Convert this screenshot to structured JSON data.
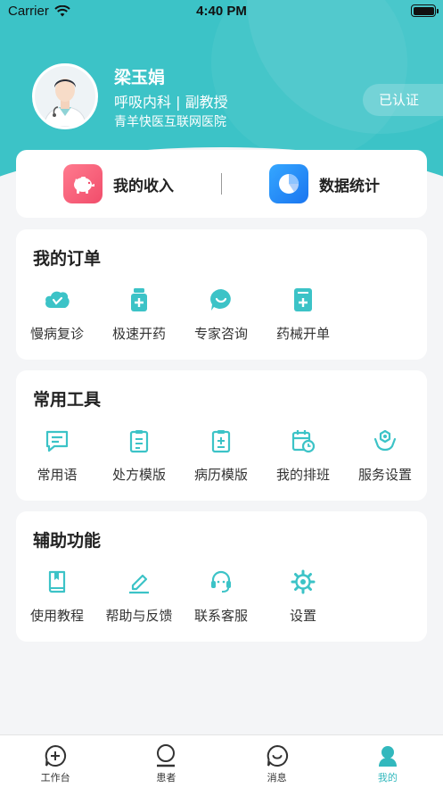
{
  "status_bar": {
    "carrier": "Carrier",
    "time": "4:40 PM"
  },
  "profile": {
    "name": "梁玉娟",
    "department": "呼吸内科 | 副教授",
    "hospital": "青羊快医互联网医院",
    "verified_badge": "已认证"
  },
  "income": {
    "my_income_label": "我的收入",
    "my_income_icon": "piggy-bank-icon",
    "statistics_label": "数据统计",
    "statistics_icon": "pie-chart-icon"
  },
  "orders": {
    "title": "我的订单",
    "items": [
      {
        "label": "慢病复诊",
        "icon": "chronic-followup-icon"
      },
      {
        "label": "极速开药",
        "icon": "medicine-bottle-icon"
      },
      {
        "label": "专家咨询",
        "icon": "chat-bubble-icon"
      },
      {
        "label": "药械开单",
        "icon": "prescription-form-icon"
      }
    ]
  },
  "tools": {
    "title": "常用工具",
    "items": [
      {
        "label": "常用语",
        "icon": "phrases-icon"
      },
      {
        "label": "处方模版",
        "icon": "clipboard-icon"
      },
      {
        "label": "病历模版",
        "icon": "medical-record-icon"
      },
      {
        "label": "我的排班",
        "icon": "calendar-clock-icon"
      },
      {
        "label": "服务设置",
        "icon": "service-hands-icon"
      }
    ]
  },
  "aux": {
    "title": "辅助功能",
    "items": [
      {
        "label": "使用教程",
        "icon": "book-icon"
      },
      {
        "label": "帮助与反馈",
        "icon": "edit-pen-icon"
      },
      {
        "label": "联系客服",
        "icon": "headset-icon"
      },
      {
        "label": "设置",
        "icon": "gear-icon"
      }
    ]
  },
  "tabbar": {
    "items": [
      {
        "label": "工作台",
        "icon": "workbench-plus-icon",
        "active": false
      },
      {
        "label": "患者",
        "icon": "patient-icon",
        "active": false
      },
      {
        "label": "消息",
        "icon": "message-icon",
        "active": false
      },
      {
        "label": "我的",
        "icon": "profile-icon",
        "active": true
      }
    ]
  },
  "colors": {
    "brand": "#3cc3c7",
    "active_tab": "#32b8bd",
    "income_pink": "#f14d6b",
    "stats_blue": "#1a75f0"
  }
}
